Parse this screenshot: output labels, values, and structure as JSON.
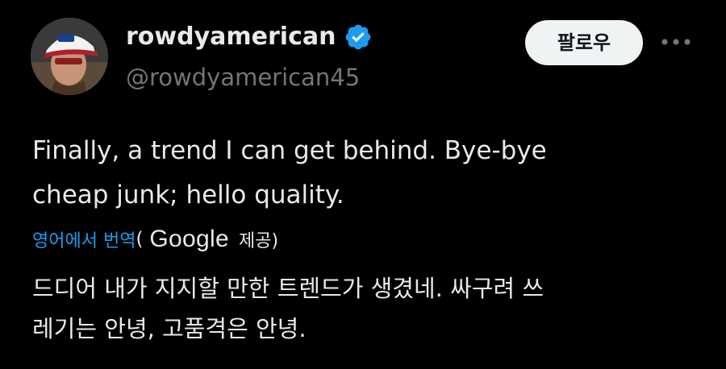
{
  "colors": {
    "background": "#000000",
    "primary_text": "#e7e9ea",
    "secondary_text": "#71767b",
    "accent": "#1d9bf0",
    "follow_button_bg": "#eff3f4",
    "follow_button_text": "#0f1419"
  },
  "author": {
    "display_name": "rowdyamerican",
    "handle": "@rowdyamerican45",
    "verified": true,
    "verified_icon": "verified-badge-icon",
    "avatar_icon": "user-avatar"
  },
  "actions": {
    "follow_label": "팔로우",
    "more_icon": "more-horizontal-icon"
  },
  "tweet": {
    "text": "Finally, a trend I can get behind. Bye-bye\ncheap junk; hello quality."
  },
  "translation": {
    "link_label": "영어에서 번역",
    "open_paren": "(",
    "provider": "Google",
    "provided_label": "제공)",
    "text": "드디어 내가 지지할 만한 트렌드가 생겼네. 싸구려 쓰\n레기는 안녕, 고품격은 안녕."
  }
}
